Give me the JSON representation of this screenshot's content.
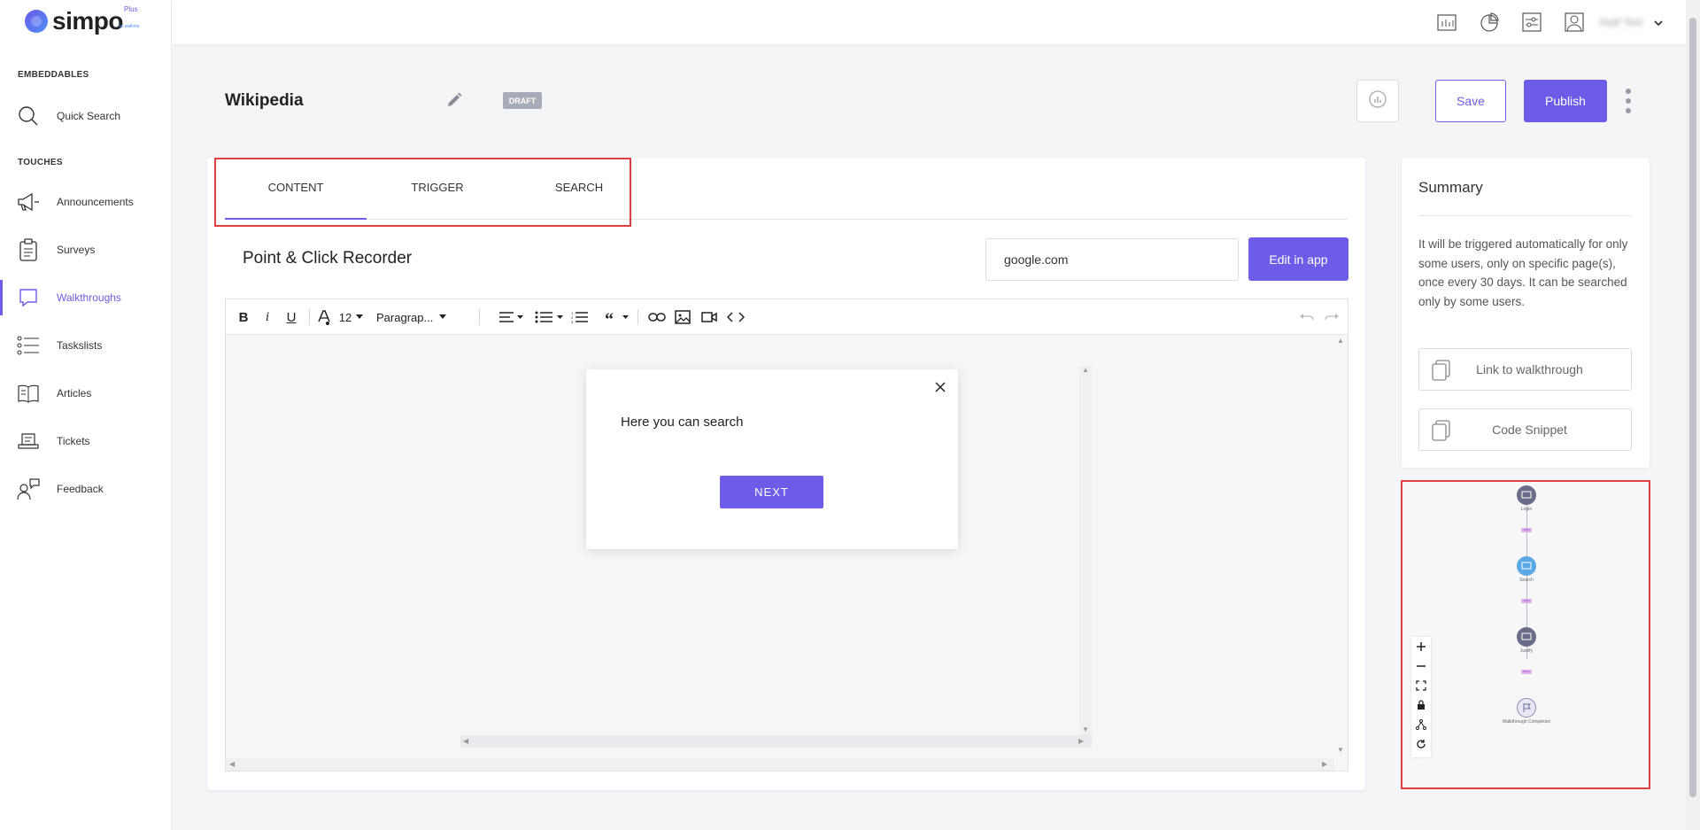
{
  "brand": {
    "name": "simpo",
    "plus": "Plus",
    "by": "by walkme"
  },
  "sidebar": {
    "sections": {
      "embeddables": "EMBEDDABLES",
      "touches": "TOUCHES"
    },
    "items": [
      {
        "label": "Quick Search",
        "icon": "search-icon"
      },
      {
        "label": "Announcements",
        "icon": "megaphone-icon"
      },
      {
        "label": "Surveys",
        "icon": "clipboard-icon"
      },
      {
        "label": "Walkthroughs",
        "icon": "chat-bubble-icon",
        "active": true
      },
      {
        "label": "Taskslists",
        "icon": "list-icon"
      },
      {
        "label": "Articles",
        "icon": "book-icon"
      },
      {
        "label": "Tickets",
        "icon": "ticket-icon"
      },
      {
        "label": "Feedback",
        "icon": "feedback-icon"
      }
    ]
  },
  "topbar": {
    "username": "Asaf Test"
  },
  "header": {
    "title": "Wikipedia",
    "status": "DRAFT",
    "save": "Save",
    "publish": "Publish"
  },
  "tabs": [
    {
      "label": "CONTENT",
      "active": true
    },
    {
      "label": "TRIGGER"
    },
    {
      "label": "SEARCH"
    }
  ],
  "recorder": {
    "title": "Point & Click Recorder",
    "url": "google.com",
    "edit_button": "Edit in app"
  },
  "toolbar": {
    "bold": "B",
    "italic": "i",
    "underline": "U",
    "font_size": "12",
    "paragraph": "Paragrap..."
  },
  "popup": {
    "text": "Here you can search",
    "next": "NEXT"
  },
  "summary": {
    "title": "Summary",
    "text": "It will be triggered automatically for only some users, only on specific page(s), once every 30 days. It can be searched only by some users.",
    "link_button": "Link to walkthrough",
    "snippet_button": "Code Snippet"
  },
  "flow": {
    "nodes": [
      {
        "label": "Login"
      },
      {
        "label": "Search"
      },
      {
        "label": "Justify"
      },
      {
        "label": "Walkthrough Completion"
      }
    ],
    "tags": [
      "Click",
      "Click",
      "Show"
    ]
  },
  "colors": {
    "accent": "#6c5ce7",
    "highlight": "#e04040"
  }
}
